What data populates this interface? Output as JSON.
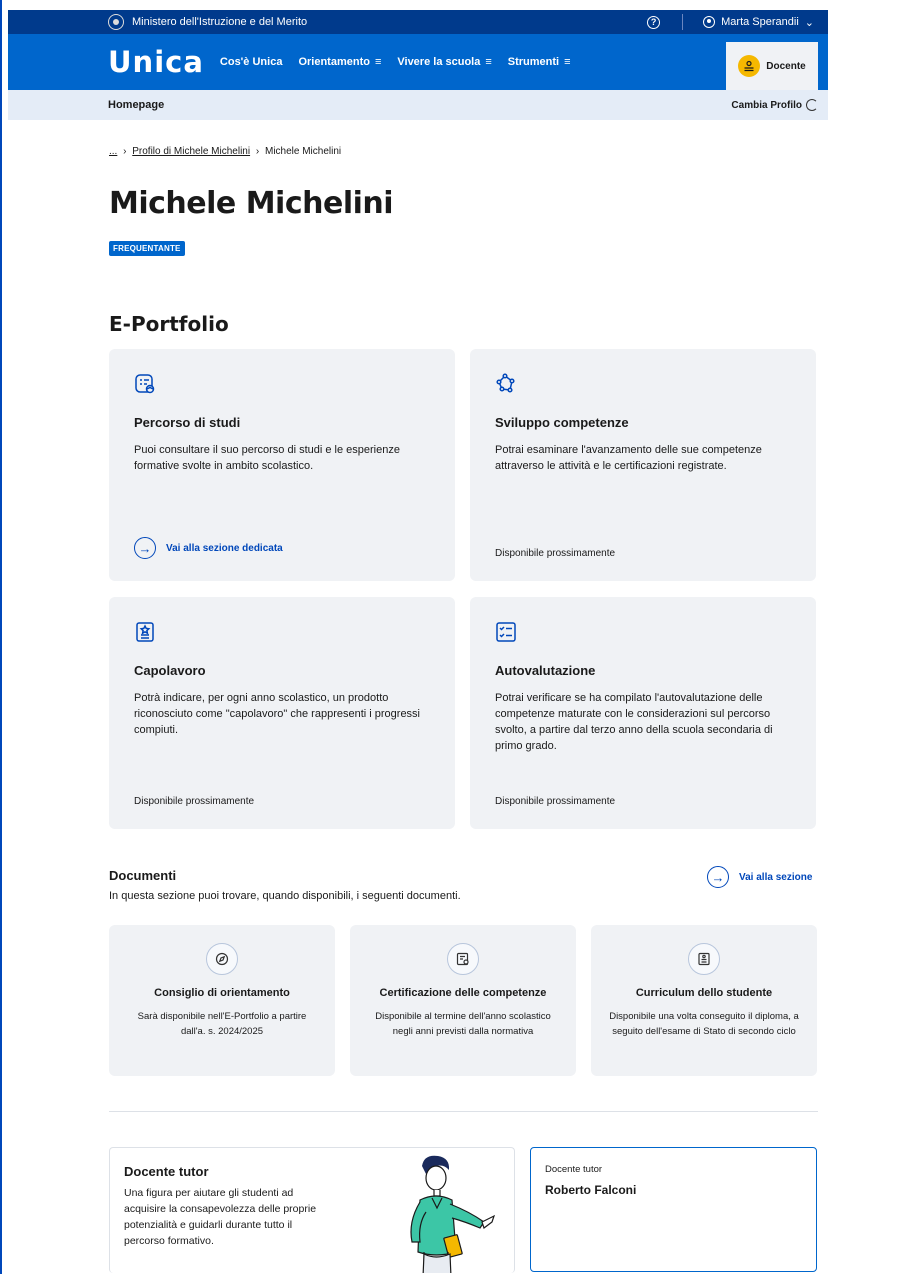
{
  "topbar": {
    "ministry": "Ministero dell'Istruzione e del Merito",
    "help_icon": "help-circle-icon",
    "user_name": "Marta Sperandii",
    "user_chevron": "⌄"
  },
  "navbar": {
    "logo": "Unica",
    "items": [
      {
        "label": "Cos'è Unica",
        "menu": ""
      },
      {
        "label": "Orientamento",
        "menu": "≡"
      },
      {
        "label": "Vivere la scuola",
        "menu": "≡"
      },
      {
        "label": "Strumenti",
        "menu": "≡"
      }
    ],
    "profile_tab": "Docente"
  },
  "subbar": {
    "home": "Homepage",
    "switch_profile": "Cambia Profilo"
  },
  "breadcrumb": {
    "ellipsis": "...",
    "parent": "Profilo di Michele Michelini",
    "current": "Michele Michelini"
  },
  "page": {
    "title": "Michele Michelini",
    "status": "FREQUENTANTE",
    "section_title": "E-Portfolio"
  },
  "cards": [
    {
      "title": "Percorso di studi",
      "desc": "Puoi consultare il suo percorso di studi e le esperienze formative svolte in ambito scolastico.",
      "foot": "Vai alla sezione dedicata"
    },
    {
      "title": "Sviluppo competenze",
      "desc": "Potrai esaminare l'avanzamento delle sue competenze attraverso le attività e le certificazioni registrate.",
      "foot": "Disponibile prossimamente"
    },
    {
      "title": "Capolavoro",
      "desc": "Potrà indicare, per ogni anno scolastico, un prodotto riconosciuto come \"capolavoro\" che rappresenti i progressi compiuti.",
      "foot": "Disponibile prossimamente"
    },
    {
      "title": "Autovalutazione",
      "desc": "Potrai verificare se ha compilato l'autovalutazione delle competenze maturate con le considerazioni sul percorso svolto, a partire dal terzo anno della scuola secondaria di primo grado.",
      "foot": "Disponibile prossimamente"
    }
  ],
  "documents": {
    "title": "Documenti",
    "subtitle": "In questa sezione puoi trovare, quando disponibili, i seguenti documenti.",
    "link": "Vai alla sezione",
    "items": [
      {
        "title": "Consiglio di orientamento",
        "desc": "Sarà disponibile nell'E-Portfolio a partire dall'a. s. 2024/2025"
      },
      {
        "title": "Certificazione delle competenze",
        "desc": "Disponibile al termine dell'anno scolastico negli anni previsti dalla normativa"
      },
      {
        "title": "Curriculum dello studente",
        "desc": "Disponibile una volta conseguito il diploma, a seguito dell'esame di Stato di secondo ciclo"
      }
    ]
  },
  "tutor": {
    "title": "Docente tutor",
    "desc": "Una figura per aiutare gli studenti ad acquisire la consapevolezza delle proprie potenzialità e guidarli durante tutto il percorso formativo.",
    "label": "Docente tutor",
    "name": "Roberto Falconi"
  },
  "colors": {
    "topbar": "#003a8c",
    "navbar": "#0066cc",
    "accent": "#0047ba",
    "badge": "#0066cc",
    "docente_icon": "#f5b800"
  }
}
